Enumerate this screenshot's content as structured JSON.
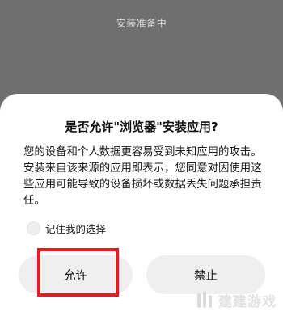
{
  "header": {
    "status_text": "安装准备中"
  },
  "dialog": {
    "title": "是否允许\"浏览器\"安装应用?",
    "message": "您的设备和个人数据更容易受到未知应用的攻击。安装来自该来源的应用即表示，您同意对因使用这些应用可能导致的设备损坏或数据丢失问题承担责任。",
    "remember_label": "记住我的选择",
    "allow_label": "允许",
    "deny_label": "禁止"
  },
  "highlight_color": "#e02020",
  "watermark": {
    "text": "建建游戏"
  }
}
